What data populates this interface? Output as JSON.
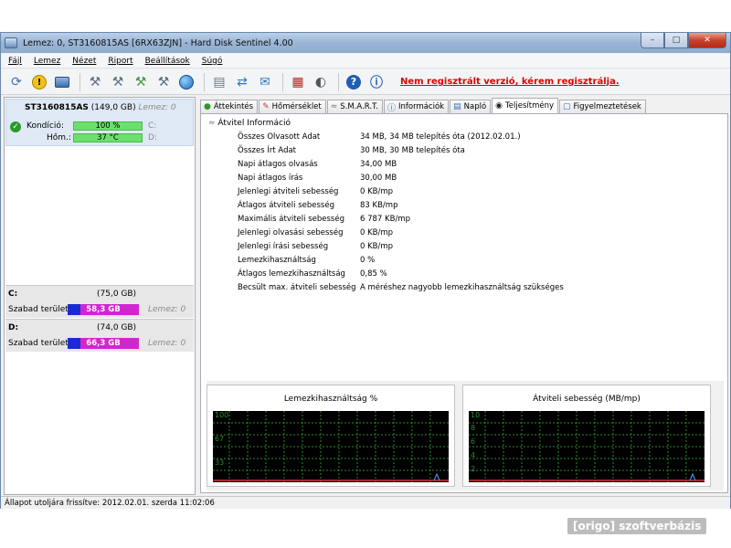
{
  "window": {
    "title": "Lemez: 0, ST3160815AS [6RX63ZJN]  -  Hard Disk Sentinel 4.00",
    "controls": [
      "–",
      "□",
      "✕"
    ]
  },
  "menu": [
    "Fájl",
    "Lemez",
    "Nézet",
    "Riport",
    "Beállítások",
    "Súgó"
  ],
  "toolbar": {
    "buttons": [
      "refresh-icon",
      "alert-icon",
      "disk-icon",
      "tool1-icon",
      "tool2-icon",
      "tool3-icon",
      "tool4-icon",
      "globe-icon",
      "doc-icon",
      "sync-icon",
      "send-icon",
      "chart-icon",
      "sound-icon",
      "help-icon",
      "info-icon"
    ],
    "register_link": "Nem regisztrált verzió, kérem regisztrálja."
  },
  "disk": {
    "name": "ST3160815AS",
    "size": "(149,0 GB)",
    "lemez": "Lemez: 0",
    "condition_label": "Kondíció:",
    "condition_value": "100 %",
    "condition_drive": "C:",
    "temp_label": "Hőm.:",
    "temp_value": "37 °C",
    "temp_drive": "D:"
  },
  "drives": [
    {
      "letter": "C:",
      "size": "(75,0 GB)",
      "free_label": "Szabad terület",
      "free": "58,3 GB",
      "lemez": "Lemez: 0"
    },
    {
      "letter": "D:",
      "size": "(74,0 GB)",
      "free_label": "Szabad terület",
      "free": "66,3 GB",
      "lemez": "Lemez: 0"
    }
  ],
  "tabs": [
    {
      "label": "Áttekintés",
      "icon": "check-icon"
    },
    {
      "label": "Hőmérséklet",
      "icon": "thermometer-icon"
    },
    {
      "label": "S.M.A.R.T.",
      "icon": "smart-icon"
    },
    {
      "label": "Információk",
      "icon": "info-icon"
    },
    {
      "label": "Napló",
      "icon": "log-icon"
    },
    {
      "label": "Teljesítmény",
      "icon": "gauge-icon"
    },
    {
      "label": "Figyelmeztetések",
      "icon": "warning-doc-icon"
    }
  ],
  "active_tab": "Teljesítmény",
  "section_title": "Átvitel Információ",
  "info": [
    {
      "label": "Összes Olvasott Adat",
      "value": "34 MB,  34 MB telepítés óta  (2012.02.01.)"
    },
    {
      "label": "Összes Írt Adat",
      "value": "30 MB,  30 MB telepítés óta"
    },
    {
      "label": "Napi átlagos olvasás",
      "value": "34,00 MB"
    },
    {
      "label": "Napi átlagos írás",
      "value": "30,00 MB"
    },
    {
      "label": "Jelenlegi átviteli sebesség",
      "value": "0 KB/mp"
    },
    {
      "label": "Átlagos átviteli sebesség",
      "value": "83 KB/mp"
    },
    {
      "label": "Maximális átviteli sebesség",
      "value": "6 787 KB/mp"
    },
    {
      "label": "Jelenlegi olvasási sebesség",
      "value": "0 KB/mp"
    },
    {
      "label": "Jelenlegi írási sebesség",
      "value": "0 KB/mp"
    },
    {
      "label": "Lemezkihasználtság",
      "value": "0 %"
    },
    {
      "label": "Átlagos lemezkihasználtság",
      "value": "0,85 %"
    },
    {
      "label": "Becsült max. átviteli sebesség",
      "value": "A méréshez nagyobb lemezkihasználtság szükséges"
    }
  ],
  "graphs": [
    {
      "title": "Lemezkihasználtság %",
      "labels": [
        "100",
        "67",
        "33"
      ]
    },
    {
      "title": "Átviteli sebesség (MB/mp)",
      "labels": [
        "10",
        "8",
        "6",
        "4",
        "2"
      ]
    }
  ],
  "status": "Állapot utoljára frissítve: 2012.02.01. szerda 11:02:06",
  "watermark": "[origo] szoftverbázis",
  "colors": {
    "accent_red": "#e00000",
    "bar_green": "#6ce06c",
    "drive_bar": "#d026d0",
    "drive_bar_blue": "#1b2bd0",
    "graph_bg": "#000000",
    "graph_grid": "#2a8a2a"
  }
}
